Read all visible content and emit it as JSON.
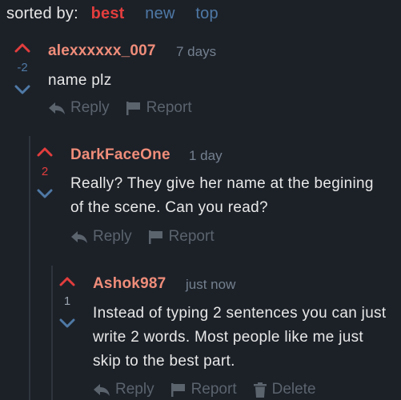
{
  "sort": {
    "label": "sorted by:",
    "options": [
      "best",
      "new",
      "top"
    ],
    "active": "best"
  },
  "colors": {
    "upvote": "#e23d3d",
    "downvote": "#4f79a6",
    "author": "#f08d7a",
    "muted": "#5b636d"
  },
  "comments": [
    {
      "author": "alexxxxxx_007",
      "time": "7 days",
      "score": "-2",
      "text": "name plz",
      "actions": [
        "Reply",
        "Report"
      ]
    },
    {
      "author": "DarkFaceOne",
      "time": "1 day",
      "score": "2",
      "text": "Really? They give her name at the begining of the scene. Can you read?",
      "actions": [
        "Reply",
        "Report"
      ]
    },
    {
      "author": "Ashok987",
      "time": "just now",
      "score": "1",
      "text": "Instead of typing 2 sentences you can just write 2 words. Most people like me just skip to the best part.",
      "actions": [
        "Reply",
        "Report",
        "Delete"
      ]
    }
  ]
}
